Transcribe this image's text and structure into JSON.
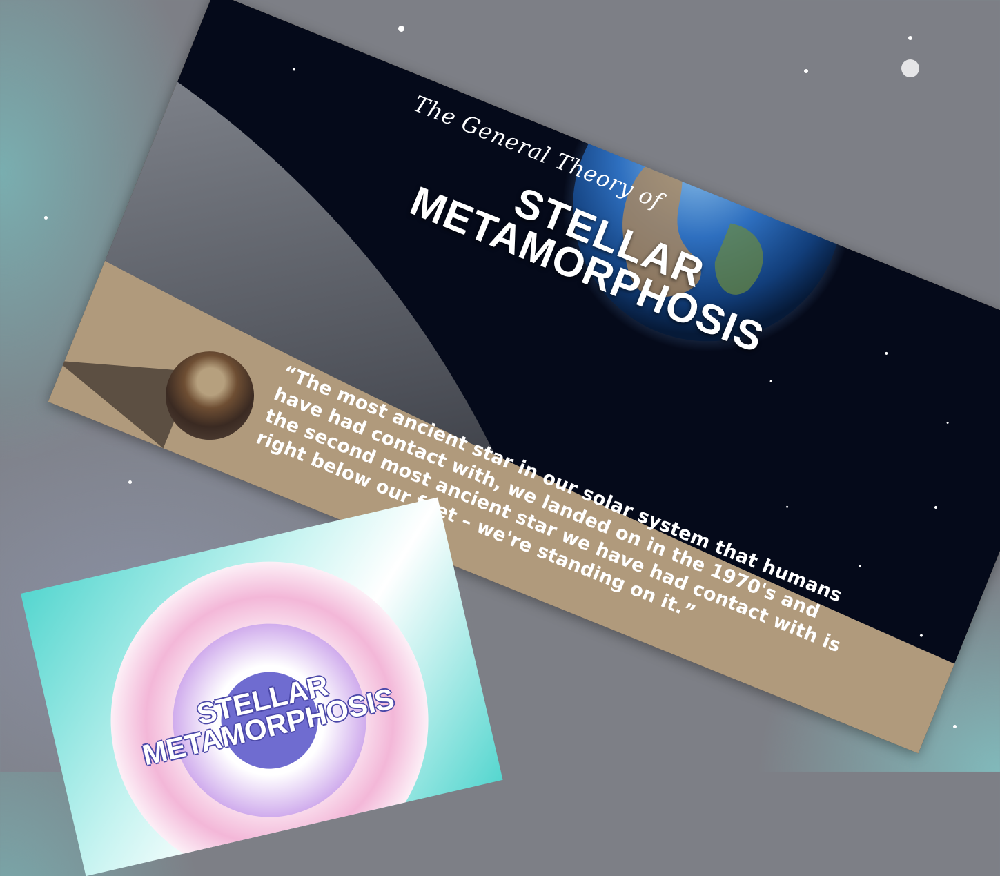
{
  "card": {
    "subtitle": "The General Theory of",
    "title_line_1": "STELLAR",
    "title_line_2": "METAMORPHOSIS",
    "quote": "“The most ancient star in our solar system that humans have had contact with, we landed on in the 1970's and the second most ancient star we have had contact with is right below our feet – we're standing on it.”"
  },
  "thumbnail": {
    "title_line_1": "STELLAR",
    "title_line_2": "METAMORPHOSIS"
  },
  "colors": {
    "card_tan": "#b09a7c",
    "space": "#050a1a",
    "earth_blue": "#1f5fb0",
    "thumb_teal": "#55d6cf",
    "thumb_pink": "#f3b7d8",
    "thumb_purple": "#6f6cd0"
  }
}
